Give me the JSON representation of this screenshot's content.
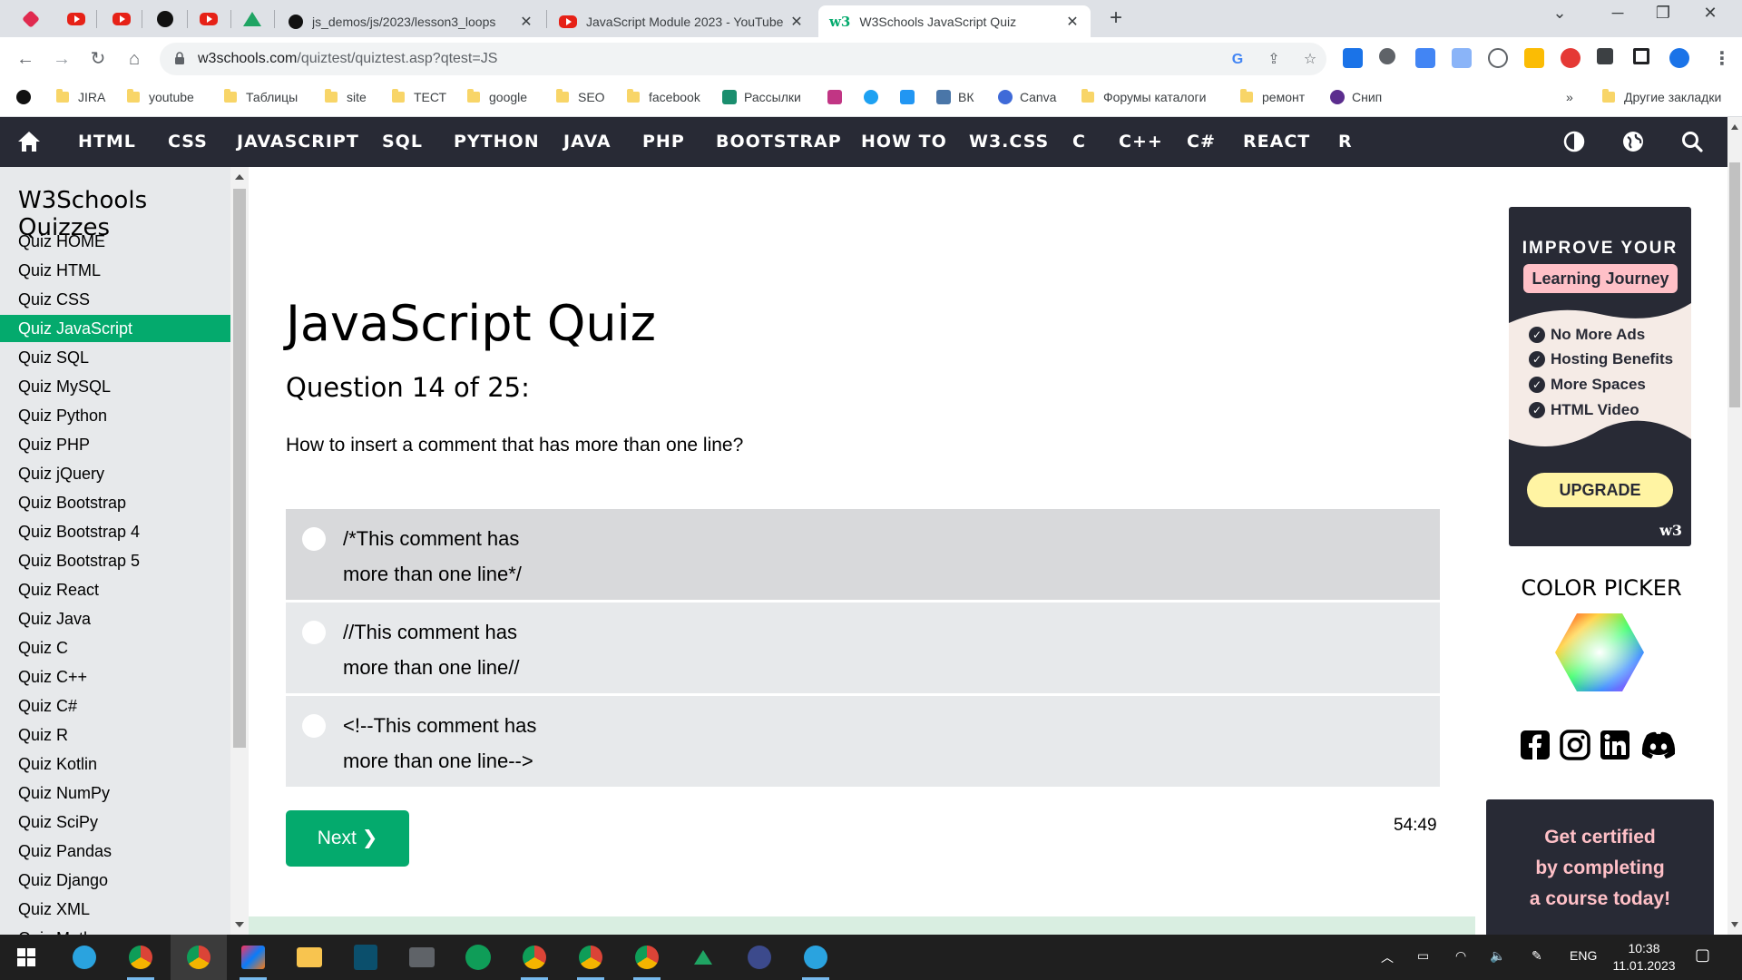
{
  "browser": {
    "tabs": [
      {
        "title": "js_demos/js/2023/lesson3_loops",
        "icon": "github-icon"
      },
      {
        "title": "JavaScript Module 2023 - YouTube",
        "icon": "youtube-icon"
      },
      {
        "title": "W3Schools JavaScript Quiz",
        "icon": "w3schools-icon",
        "active": true
      }
    ],
    "w3_favicon": "w3",
    "url_host": "w3schools.com",
    "url_path": "/quiztest/quiztest.asp?qtest=JS"
  },
  "bookmarks": {
    "items": [
      {
        "label": "JIRA",
        "type": "folder"
      },
      {
        "label": "youtube",
        "type": "folder"
      },
      {
        "label": "Таблицы",
        "type": "folder"
      },
      {
        "label": "site",
        "type": "folder"
      },
      {
        "label": "ТЕСТ",
        "type": "folder"
      },
      {
        "label": "google",
        "type": "folder"
      },
      {
        "label": "SEO",
        "type": "folder"
      },
      {
        "label": "facebook",
        "type": "folder"
      },
      {
        "label": "Рассылки",
        "type": "link"
      },
      {
        "label": "ВК",
        "type": "link"
      },
      {
        "label": "Canva",
        "type": "link"
      },
      {
        "label": "Форумы каталоги",
        "type": "folder"
      },
      {
        "label": "ремонт",
        "type": "folder"
      },
      {
        "label": "Снип",
        "type": "link"
      }
    ],
    "overflow": "»",
    "other": "Другие закладки"
  },
  "w3nav": {
    "items": [
      "HTML",
      "CSS",
      "JAVASCRIPT",
      "SQL",
      "PYTHON",
      "JAVA",
      "PHP",
      "BOOTSTRAP",
      "HOW TO",
      "W3.CSS",
      "C",
      "C++",
      "C#",
      "REACT",
      "R"
    ]
  },
  "sidebar": {
    "title": "W3Schools Quizzes",
    "items": [
      "Quiz HOME",
      "Quiz HTML",
      "Quiz CSS",
      "Quiz JavaScript",
      "Quiz SQL",
      "Quiz MySQL",
      "Quiz Python",
      "Quiz PHP",
      "Quiz jQuery",
      "Quiz Bootstrap",
      "Quiz Bootstrap 4",
      "Quiz Bootstrap 5",
      "Quiz React",
      "Quiz Java",
      "Quiz C",
      "Quiz C++",
      "Quiz C#",
      "Quiz R",
      "Quiz Kotlin",
      "Quiz NumPy",
      "Quiz SciPy",
      "Quiz Pandas",
      "Quiz Django",
      "Quiz XML",
      "Quiz Math"
    ],
    "selected": "Quiz JavaScript"
  },
  "quiz": {
    "title": "JavaScript Quiz",
    "question_label": "Question 14 of 25:",
    "question": "How to insert a comment that has more than one line?",
    "options": [
      {
        "line1": "/*This comment has",
        "line2": "more than one line*/"
      },
      {
        "line1": "//This comment has",
        "line2": "more than one line//"
      },
      {
        "line1": "<!--This comment has",
        "line2": "more than one line-->"
      }
    ],
    "next_label": "Next ❯",
    "timer": "54:49"
  },
  "ad": {
    "heading": "IMPROVE YOUR",
    "pill": "Learning Journey",
    "features": [
      "No More Ads",
      "Hosting Benefits",
      "More Spaces",
      "HTML Video"
    ],
    "upgrade": "UPGRADE",
    "logo": "w3"
  },
  "color_picker": {
    "title": "COLOR PICKER"
  },
  "certified": {
    "line1": "Get certified",
    "line2": "by completing",
    "line3": "a course today!"
  },
  "taskbar": {
    "language": "ENG",
    "time": "10:38",
    "date": "11.01.2023"
  },
  "colors": {
    "w3_green": "#04aa6d",
    "w3_dark": "#282a35",
    "sidebar_bg": "#e7e9eb",
    "option_bg": "#e7e9eb",
    "pink": "#ffc0c7",
    "yellow": "#fff4a3"
  }
}
